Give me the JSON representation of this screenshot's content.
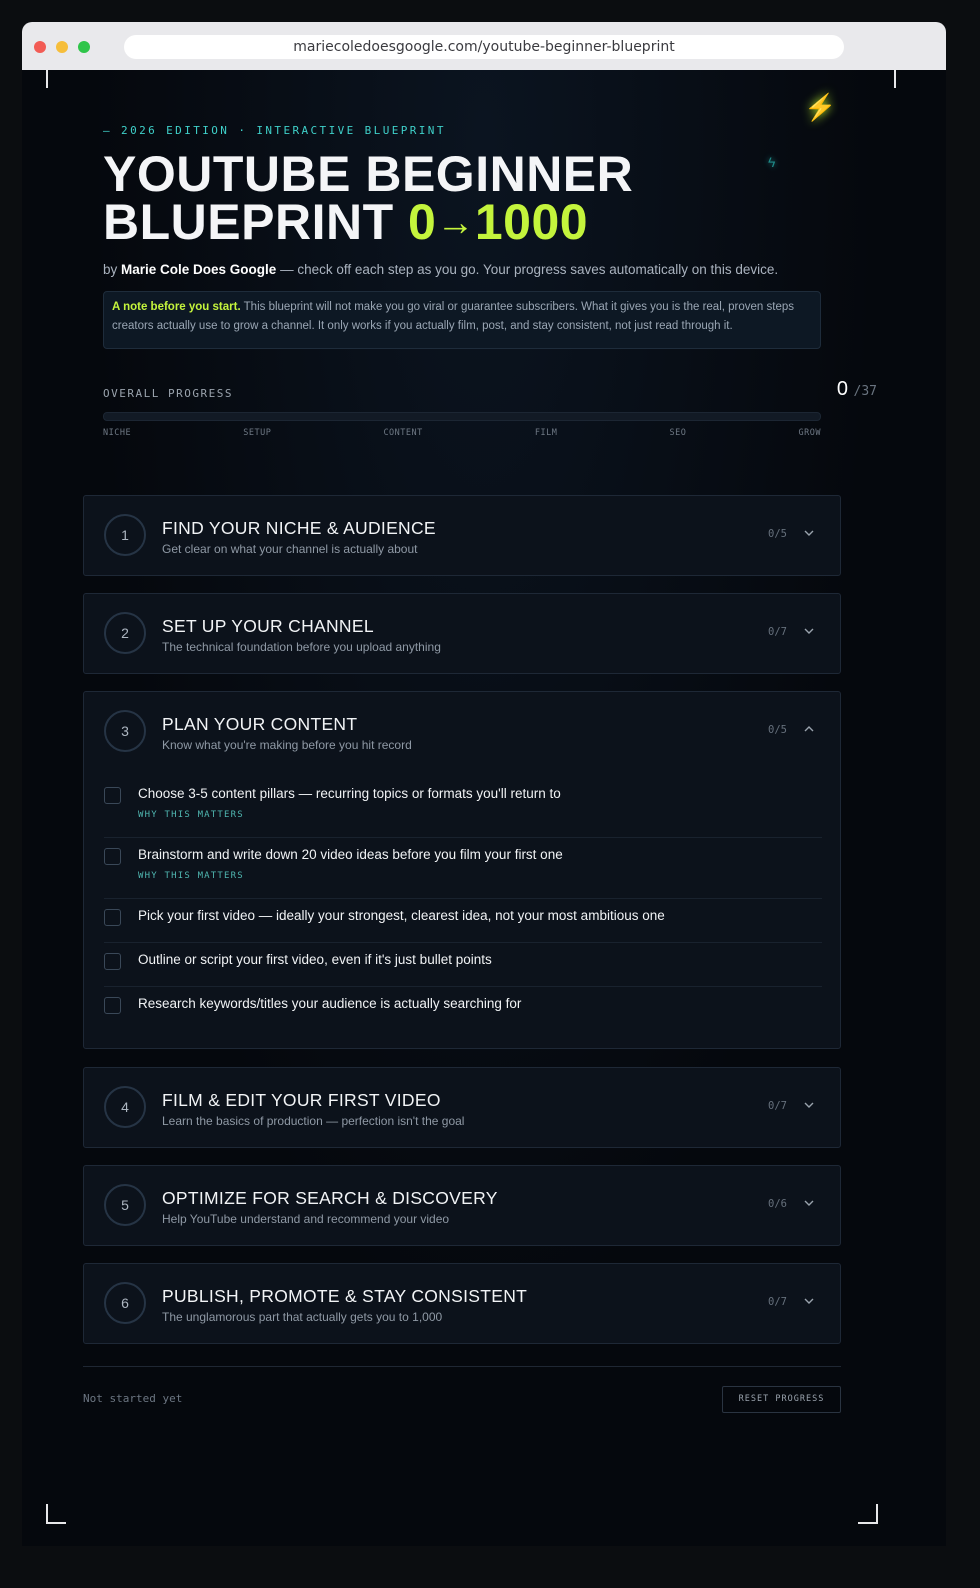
{
  "browser": {
    "url": "mariecoledoesgoogle.com/youtube-beginner-blueprint"
  },
  "hero": {
    "eyebrow": "— 2026 EDITION · INTERACTIVE BLUEPRINT",
    "title_line1": "YOUTUBE BEGINNER",
    "title_line2": "BLUEPRINT",
    "title_accent": "0 1000",
    "title_accent_from": "0",
    "title_accent_arrow": "→",
    "title_accent_to": "1000",
    "byline_prefix": "by ",
    "byline_author": "Marie Cole Does Google",
    "byline_suffix": " — check off each step as you go. Your progress saves automatically on this device.",
    "note_lead": "A note before you start.",
    "note_body": " This blueprint will not make you go viral or guarantee subscribers. What it gives you is the real, proven steps creators actually use to grow a channel. It only works if you actually film, post, and stay consistent, not just read through it."
  },
  "progress": {
    "label": "OVERALL PROGRESS",
    "done": "0",
    "total": "/37",
    "fraction": 0,
    "stages": [
      "NICHE",
      "SETUP",
      "CONTENT",
      "FILM",
      "SEO",
      "GROW"
    ]
  },
  "sections": [
    {
      "num": "1",
      "title": "FIND YOUR NICHE & AUDIENCE",
      "subtitle": "Get clear on what your channel is actually about",
      "count": "0/5",
      "expanded": false
    },
    {
      "num": "2",
      "title": "SET UP YOUR CHANNEL",
      "subtitle": "The technical foundation before you upload anything",
      "count": "0/7",
      "expanded": false
    },
    {
      "num": "3",
      "title": "PLAN YOUR CONTENT",
      "subtitle": "Know what you're making before you hit record",
      "count": "0/5",
      "expanded": true,
      "tasks": [
        {
          "text": "Choose 3-5 content pillars — recurring topics or formats you'll return to",
          "why": "WHY THIS MATTERS",
          "checked": false
        },
        {
          "text": "Brainstorm and write down 20 video ideas before you film your first one",
          "why": "WHY THIS MATTERS",
          "checked": false
        },
        {
          "text": "Pick your first video — ideally your strongest, clearest idea, not your most ambitious one",
          "checked": false
        },
        {
          "text": "Outline or script your first video, even if it's just bullet points",
          "checked": false
        },
        {
          "text": "Research keywords/titles your audience is actually searching for",
          "checked": false
        }
      ]
    },
    {
      "num": "4",
      "title": "FILM & EDIT YOUR FIRST VIDEO",
      "subtitle": "Learn the basics of production — perfection isn't the goal",
      "count": "0/7",
      "expanded": false
    },
    {
      "num": "5",
      "title": "OPTIMIZE FOR SEARCH & DISCOVERY",
      "subtitle": "Help YouTube understand and recommend your video",
      "count": "0/6",
      "expanded": false
    },
    {
      "num": "6",
      "title": "PUBLISH, PROMOTE & STAY CONSISTENT",
      "subtitle": "The unglamorous part that actually gets you to 1,000",
      "count": "0/7",
      "expanded": false
    }
  ],
  "footer": {
    "status": "Not started yet",
    "reset_label": "RESET PROGRESS"
  },
  "colors": {
    "accent": "#c4f43c",
    "teal": "#3fd0c9",
    "background": "#04070c",
    "card": "#0c121b"
  }
}
